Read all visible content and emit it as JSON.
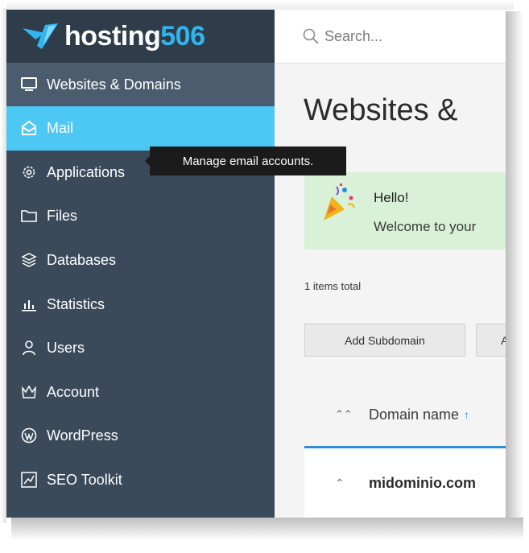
{
  "brand": {
    "name_main": "hosting",
    "name_num": "506",
    "accent": "#31b5f0"
  },
  "sidebar": {
    "items": [
      {
        "label": "Websites & Domains",
        "icon": "monitor-icon",
        "state": "section"
      },
      {
        "label": "Mail",
        "icon": "mail-icon",
        "state": "active"
      },
      {
        "label": "Applications",
        "icon": "gear-icon"
      },
      {
        "label": "Files",
        "icon": "folder-icon"
      },
      {
        "label": "Databases",
        "icon": "database-icon"
      },
      {
        "label": "Statistics",
        "icon": "bar-chart-icon"
      },
      {
        "label": "Users",
        "icon": "user-icon"
      },
      {
        "label": "Account",
        "icon": "crown-icon"
      },
      {
        "label": "WordPress",
        "icon": "wordpress-icon"
      },
      {
        "label": "SEO Toolkit",
        "icon": "seo-chart-icon"
      }
    ]
  },
  "tooltip": {
    "text": "Manage email accounts."
  },
  "search": {
    "placeholder": "Search..."
  },
  "main": {
    "title": "Websites &",
    "hello": {
      "title": "Hello!",
      "text": "Welcome to your"
    },
    "items_total": "1 items total",
    "buttons": {
      "add_subdomain": "Add Subdomain",
      "second": "Ac"
    },
    "table": {
      "column_header": "Domain name",
      "sort_arrow": "↑",
      "rows": [
        {
          "domain": "midominio.com"
        }
      ]
    }
  },
  "colors": {
    "sidebar_bg": "#3a4a5a",
    "active_bg": "#4dc8f5",
    "hello_bg": "#d9f1d6",
    "accent_blue": "#2f8ad6"
  }
}
